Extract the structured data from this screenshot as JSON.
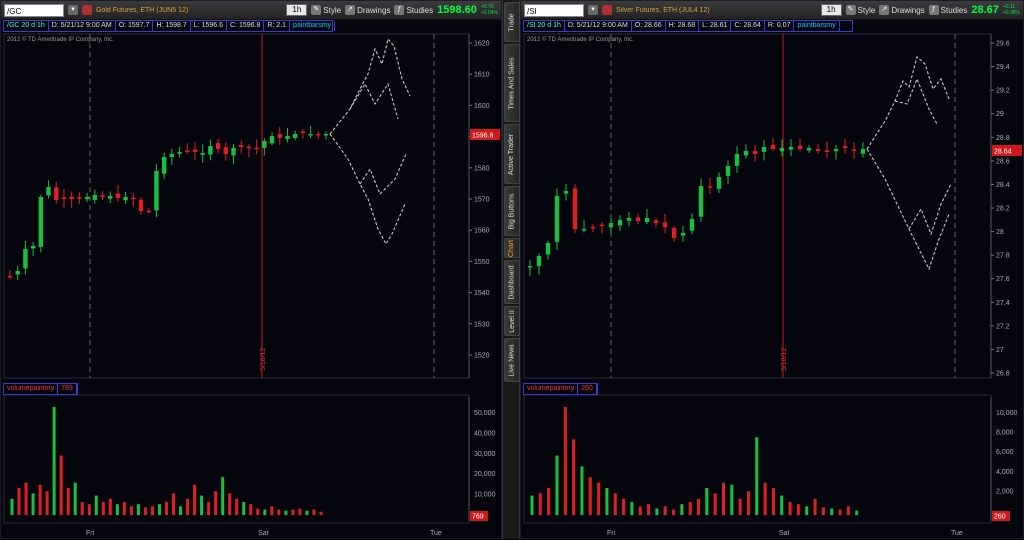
{
  "left_chart": {
    "symbol": "/GC",
    "description": "Gold Futures, ETH (JUN5 12)",
    "timeframe": "1h",
    "toolbar": {
      "style": "Style",
      "drawings": "Drawings",
      "studies": "Studies"
    },
    "price": "1598.60",
    "change_top": "+0.70",
    "change_bottom": "+0.04%",
    "info": {
      "symbol": "/GC 20 d 1h",
      "date": "D: 5/21/12 9:00 AM",
      "open": "O: 1597.7",
      "high": "H: 1598.7",
      "low": "L: 1596.6",
      "close": "C: 1596.8",
      "range": "R: 2.1",
      "study": "paintbarsmy"
    },
    "copyright": "2012 © TD Ameritrade IP Company, Inc.",
    "price_label": "1596.8",
    "volume_study": "volumepaintmy",
    "volume_value": "769",
    "volume_label": "769",
    "price_axis": [
      "1620",
      "1610",
      "1600",
      "1590",
      "1580",
      "1570",
      "1560",
      "1550",
      "1540",
      "1530",
      "1520"
    ],
    "volume_axis": [
      "50,000",
      "40,000",
      "30,000",
      "20,000",
      "10,000"
    ],
    "time_labels": [
      "Fri",
      "Sat",
      "Tue"
    ],
    "date_marker": "5/18/12"
  },
  "right_chart": {
    "symbol": "/SI",
    "description": "Silver Futures, ETH (JUL4 12)",
    "timeframe": "1h",
    "toolbar": {
      "style": "Style",
      "drawings": "Drawings",
      "studies": "Studies"
    },
    "price": "28.67",
    "change_top": "+0.11",
    "change_bottom": "+0.38%",
    "info": {
      "symbol": "/SI 20 d 1h",
      "date": "D: 5/21/12 9:00 AM",
      "open": "O: 28.66",
      "high": "H: 28.68",
      "low": "L: 28.61",
      "close": "C: 28.64",
      "range": "R: 0.07",
      "study": "paintbarsmy"
    },
    "copyright": "2012 © TD Ameritrade IP Company, Inc.",
    "price_label": "28.64",
    "volume_study": "volumepaintmy",
    "volume_value": "260",
    "volume_label": "260",
    "price_axis": [
      "29.6",
      "29.4",
      "29.2",
      "29",
      "28.8",
      "28.6",
      "28.4",
      "28.2",
      "28",
      "27.8",
      "27.6",
      "27.4",
      "27.2",
      "27",
      "26.8"
    ],
    "volume_axis": [
      "10,000",
      "8,000",
      "6,000",
      "4,000",
      "2,000"
    ],
    "time_labels": [
      "Fri",
      "Sat",
      "Tue"
    ],
    "date_marker": "5/18/12"
  },
  "side_tabs": [
    "Trade",
    "Times And Sales",
    "Active Trader",
    "Big Buttons",
    "Chart",
    "Dashboard",
    "Level II",
    "Live News"
  ],
  "active_tab": "Chart",
  "colors": {
    "up": "#18c040",
    "down": "#e02020",
    "dashed": "#c8c8c8",
    "accent": "#f0a020"
  }
}
